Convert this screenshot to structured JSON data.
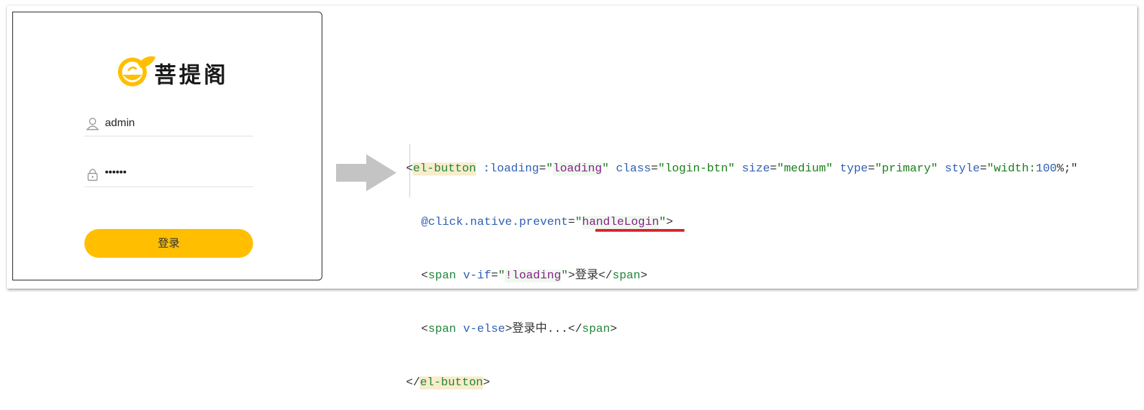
{
  "login": {
    "brand": "菩提阁",
    "username": "admin",
    "password_mask": "••••••",
    "login_button": "登录"
  },
  "code": {
    "l1": {
      "open": "<",
      "tag": "el-button",
      "a1": ":loading",
      "eq": "=",
      "v1": "\"",
      "v1var": "loading",
      "v1end": "\"",
      "a2": "class",
      "v2": "\"login-btn\"",
      "a3": "size",
      "v3": "\"medium\"",
      "a4": "type",
      "v4": "\"primary\"",
      "a5": "style",
      "v5a": "\"width:",
      "v5num": "100",
      "v5b": "%;\""
    },
    "l2": {
      "attr": "@click.native.prevent",
      "eq": "=",
      "q1": "\"",
      "val": "handleLogin",
      "q2": "\"",
      "close": ">"
    },
    "l3": {
      "open": "<",
      "tag": "span",
      "attr": "v-if",
      "eq": "=",
      "q1": "\"",
      "val": "!loading",
      "q2": "\"",
      "text": ">登录</",
      "ctag": "span",
      "close": ">"
    },
    "l4": {
      "open": "<",
      "tag": "span",
      "attr": "v-else",
      "text": ">登录中...</",
      "ctag": "span",
      "close": ">"
    },
    "l5": {
      "open": "</",
      "tag": "el-button",
      "close": ">"
    }
  },
  "colors": {
    "button": "#ffbf00",
    "logo": "#ffbf00",
    "arrow": "#c4c4c4",
    "underline": "#d8252f"
  },
  "icons": [
    "logo-icon",
    "user-icon",
    "lock-icon",
    "arrow-right-icon"
  ]
}
